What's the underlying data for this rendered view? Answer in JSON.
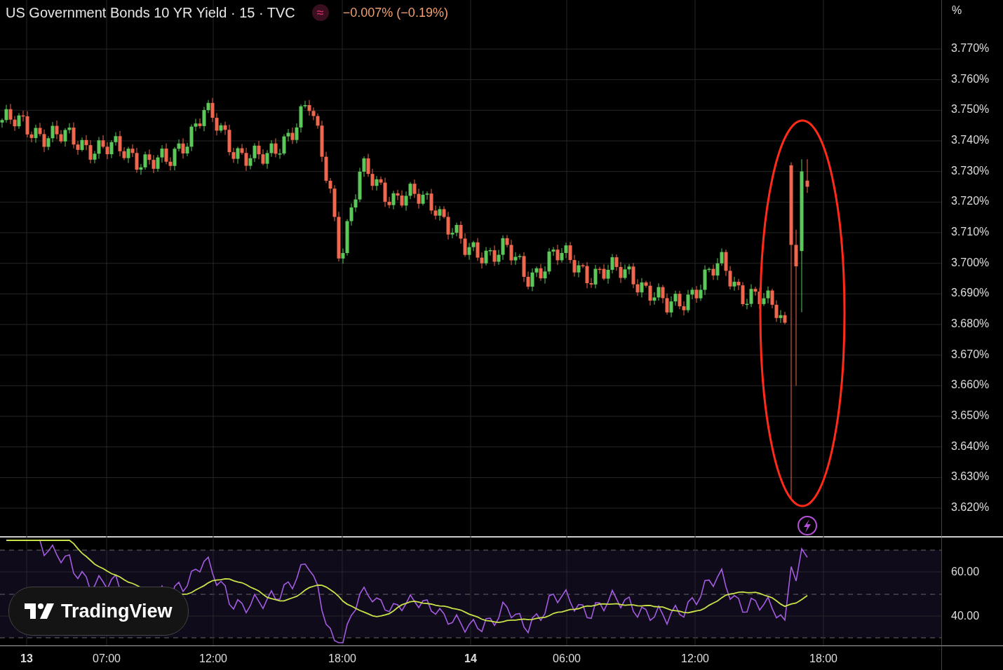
{
  "header": {
    "title": "US Government Bonds 10 YR Yield · 15 · TVC",
    "symbol_icon": "≈",
    "change": "−0.007% (−0.19%)"
  },
  "price_axis": {
    "unit": "%",
    "labels": [
      "3.770%",
      "3.760%",
      "3.750%",
      "3.740%",
      "3.730%",
      "3.720%",
      "3.710%",
      "3.700%",
      "3.690%",
      "3.680%",
      "3.670%",
      "3.660%",
      "3.650%",
      "3.640%",
      "3.630%",
      "3.620%"
    ]
  },
  "rsi_axis": {
    "labels": [
      "60.00",
      "40.00"
    ]
  },
  "time_axis": [
    {
      "label": "13",
      "kind": "day"
    },
    {
      "label": "07:00",
      "kind": "time"
    },
    {
      "label": "12:00",
      "kind": "time"
    },
    {
      "label": "18:00",
      "kind": "time"
    },
    {
      "label": "14",
      "kind": "day"
    },
    {
      "label": "06:00",
      "kind": "time"
    },
    {
      "label": "12:00",
      "kind": "time"
    },
    {
      "label": "18:00",
      "kind": "time"
    }
  ],
  "branding": {
    "name": "TradingView"
  }
}
